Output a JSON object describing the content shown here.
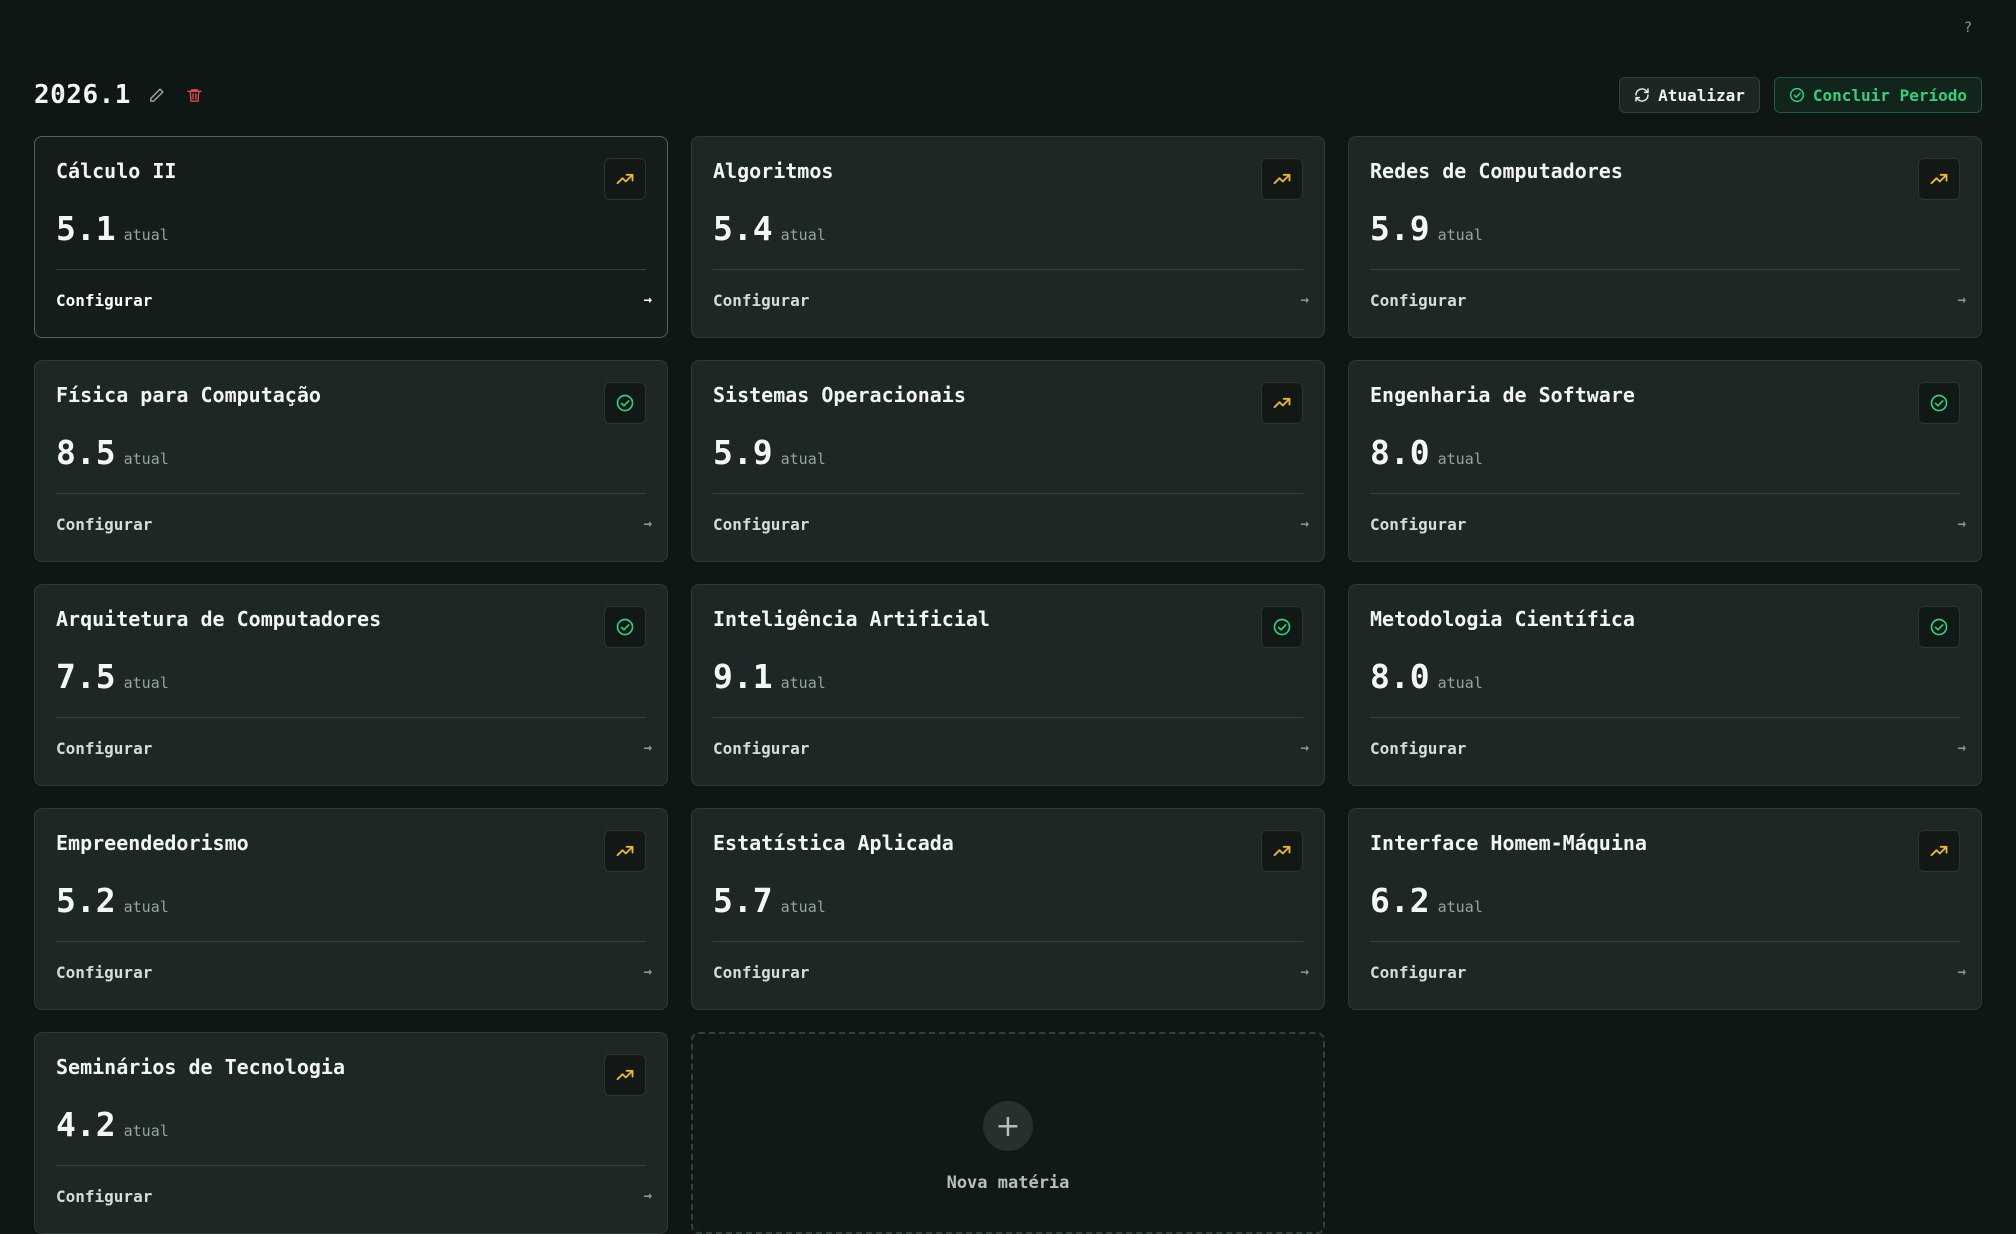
{
  "help": {
    "label": "?"
  },
  "period": {
    "title": "2026.1"
  },
  "actions": {
    "refresh_label": "Atualizar",
    "finish_label": "Concluir Período"
  },
  "colors": {
    "trend": "#e8b73a",
    "check": "#2fd07a",
    "danger": "#e0464d"
  },
  "subjects": [
    {
      "name": "Cálculo II",
      "grade": "5.1",
      "unit": "atual",
      "status": "trending-up-icon",
      "action": "Configurar",
      "active": true
    },
    {
      "name": "Algoritmos",
      "grade": "5.4",
      "unit": "atual",
      "status": "trending-up-icon",
      "action": "Configurar"
    },
    {
      "name": "Redes de Computadores",
      "grade": "5.9",
      "unit": "atual",
      "status": "trending-up-icon",
      "action": "Configurar"
    },
    {
      "name": "Física para Computação",
      "grade": "8.5",
      "unit": "atual",
      "status": "check-circle-icon",
      "action": "Configurar"
    },
    {
      "name": "Sistemas Operacionais",
      "grade": "5.9",
      "unit": "atual",
      "status": "trending-up-icon",
      "action": "Configurar"
    },
    {
      "name": "Engenharia de Software",
      "grade": "8.0",
      "unit": "atual",
      "status": "check-circle-icon",
      "action": "Configurar"
    },
    {
      "name": "Arquitetura de Computadores",
      "grade": "7.5",
      "unit": "atual",
      "status": "check-circle-icon",
      "action": "Configurar"
    },
    {
      "name": "Inteligência Artificial",
      "grade": "9.1",
      "unit": "atual",
      "status": "check-circle-icon",
      "action": "Configurar"
    },
    {
      "name": "Metodologia Científica",
      "grade": "8.0",
      "unit": "atual",
      "status": "check-circle-icon",
      "action": "Configurar"
    },
    {
      "name": "Empreendedorismo",
      "grade": "5.2",
      "unit": "atual",
      "status": "trending-up-icon",
      "action": "Configurar"
    },
    {
      "name": "Estatística Aplicada",
      "grade": "5.7",
      "unit": "atual",
      "status": "trending-up-icon",
      "action": "Configurar"
    },
    {
      "name": "Interface Homem-Máquina",
      "grade": "6.2",
      "unit": "atual",
      "status": "trending-up-icon",
      "action": "Configurar"
    },
    {
      "name": "Seminários de Tecnologia",
      "grade": "4.2",
      "unit": "atual",
      "status": "trending-up-icon",
      "action": "Configurar"
    }
  ],
  "add_subject": {
    "label": "Nova matéria"
  }
}
